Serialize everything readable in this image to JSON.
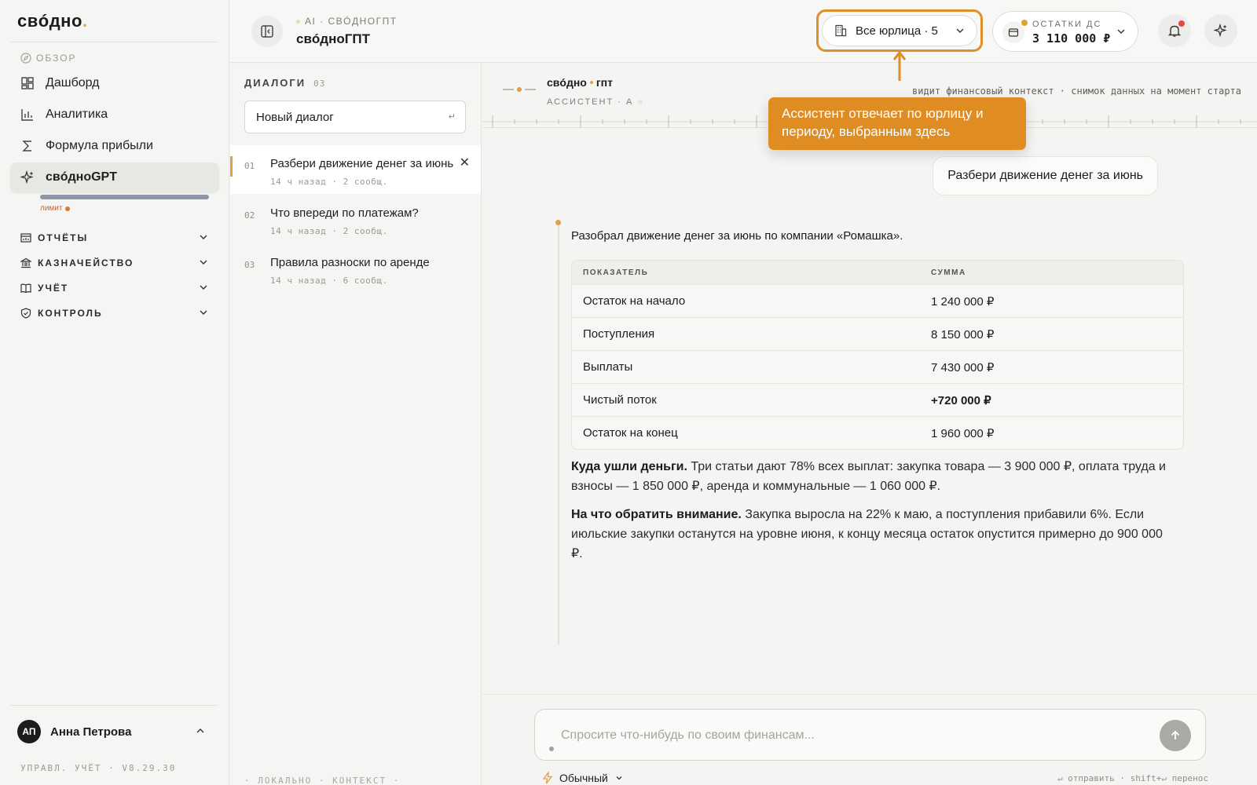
{
  "brand": {
    "logo": "свóдно",
    "logo_dot": "."
  },
  "sidebar": {
    "section_label": "ОБЗОР",
    "nav": [
      {
        "label": "Дашборд",
        "icon": "dashboard-icon"
      },
      {
        "label": "Аналитика",
        "icon": "chart-bars-icon"
      },
      {
        "label": "Формула прибыли",
        "icon": "sigma-icon"
      },
      {
        "label": "свóдноGPT",
        "icon": "sparkles-icon"
      }
    ],
    "active_index": 3,
    "limit_label": "лимит",
    "limit_usage": 1.0,
    "groups": [
      {
        "label": "ОТЧЁТЫ",
        "icon": "reports-icon"
      },
      {
        "label": "КАЗНАЧЕЙСТВО",
        "icon": "bank-icon"
      },
      {
        "label": "УЧЁТ",
        "icon": "book-icon"
      },
      {
        "label": "КОНТРОЛЬ",
        "icon": "shield-icon"
      }
    ],
    "user": {
      "initials": "АП",
      "name": "Анна Петрова"
    },
    "version": "УПРАВЛ. УЧЁТ · V8.29.30"
  },
  "topbar": {
    "crumb": "AI · СВÓДНОГПТ",
    "title": "свóдноГПТ",
    "entity_select": "Все юрлица · 5",
    "balance_label": "ОСТАТКИ ДС",
    "balance_value": "3 110 000 ₽"
  },
  "dialogs": {
    "header": "ДИАЛОГИ",
    "count": "03",
    "new_dialog_placeholder": "Новый диалог",
    "new_dialog_hint": "↵",
    "items": [
      {
        "num": "01",
        "title": "Разбери движение денег за июнь",
        "meta": "14 ч назад · 2 сообщ."
      },
      {
        "num": "02",
        "title": "Что впереди по платежам?",
        "meta": "14 ч назад · 2 сообщ."
      },
      {
        "num": "03",
        "title": "Правила разноски по аренде",
        "meta": "14 ч назад · 6 сообщ."
      }
    ],
    "footer": "· ЛОКАЛЬНО · КОНТЕКСТ ·"
  },
  "chat": {
    "assistant_name_a": "свóдно",
    "assistant_name_b": "гпт",
    "assistant_sub": "АССИСТЕНТ · А",
    "context_note": "видит финансовый контекст · снимок данных на момент старта",
    "tooltip": "Ассистент отвечает по юрлицу и периоду, выбранным здесь",
    "user_message": "Разбери движение денег за июнь",
    "answer_intro": "Разобрал движение денег за июнь по компании «Ромашка».",
    "table": {
      "headers": [
        "ПОКАЗАТЕЛЬ",
        "СУММА"
      ],
      "rows": [
        {
          "label": "Остаток на начало",
          "value": "1 240 000 ₽"
        },
        {
          "label": "Поступления",
          "value": "8 150 000 ₽"
        },
        {
          "label": "Выплаты",
          "value": "7 430 000 ₽"
        },
        {
          "label": "Чистый поток",
          "value": "+720 000 ₽"
        },
        {
          "label": "Остаток на конец",
          "value": "1 960 000 ₽"
        }
      ]
    },
    "para1_bold": "Куда ушли деньги.",
    "para1_text": " Три статьи дают 78% всех выплат: закупка товара — 3 900 000 ₽, оплата труда и взносы — 1 850 000 ₽, аренда и коммунальные — 1 060 000 ₽.",
    "para2_bold": "На что обратить внимание.",
    "para2_text": " Закупка выросла на 22% к маю, а поступления прибавили 6%. Если июльские закупки останутся на уровне июня, к концу месяца остаток опустится примерно до 900 000 ₽.",
    "composer_placeholder": "Спросите что-нибудь по своим финансам...",
    "mode": "Обычный",
    "hints": "↵ отправить · shift+↵ перенос"
  },
  "colors": {
    "accent": "#e0902b",
    "tooltip_bg": "#df8c23"
  }
}
